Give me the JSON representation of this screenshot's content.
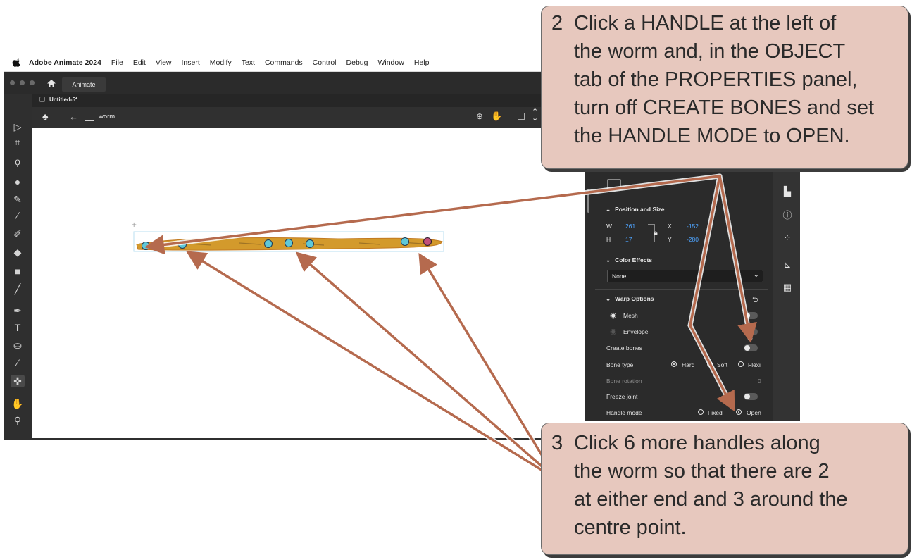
{
  "menubar": {
    "app_name": "Adobe Animate 2024",
    "items": [
      "File",
      "Edit",
      "View",
      "Insert",
      "Modify",
      "Text",
      "Commands",
      "Control",
      "Debug",
      "Window",
      "Help"
    ]
  },
  "app": {
    "home_tab": "Animate",
    "doc_tab": "Untitled-5*",
    "symbol_name": "worm"
  },
  "properties": {
    "position_size": {
      "header": "Position and Size",
      "w_label": "W",
      "w_value": "261",
      "h_label": "H",
      "h_value": "17",
      "x_label": "X",
      "x_value": "-152",
      "y_label": "Y",
      "y_value": "-280"
    },
    "color_effects": {
      "header": "Color Effects",
      "value": "None"
    },
    "warp_options": {
      "header": "Warp Options",
      "mesh_label": "Mesh",
      "envelope_label": "Envelope",
      "create_bones_label": "Create bones",
      "bone_type_label": "Bone type",
      "bone_type_options": [
        "Hard",
        "Soft",
        "Flexi"
      ],
      "bone_rotation_label": "Bone rotation",
      "bone_rotation_value": "0",
      "freeze_joint_label": "Freeze joint",
      "handle_mode_label": "Handle mode",
      "handle_mode_options": [
        "Fixed",
        "Open"
      ]
    }
  },
  "callouts": {
    "step2_number": "2",
    "step2_lines": [
      "Click a HANDLE at the left of",
      "the worm and, in the OBJECT",
      "tab of the PROPERTIES panel,",
      "turn off CREATE BONES and set",
      "the HANDLE MODE to OPEN."
    ],
    "step3_number": "3",
    "step3_lines": [
      "Click 6 more handles along",
      "the worm so that there are 2",
      "at either end and 3 around the",
      "centre point."
    ]
  },
  "colors": {
    "callout_bg": "#e7c8be",
    "arrow": "#b56a4e",
    "handle": "#5fc8d8",
    "worm": "#d39a2c"
  }
}
